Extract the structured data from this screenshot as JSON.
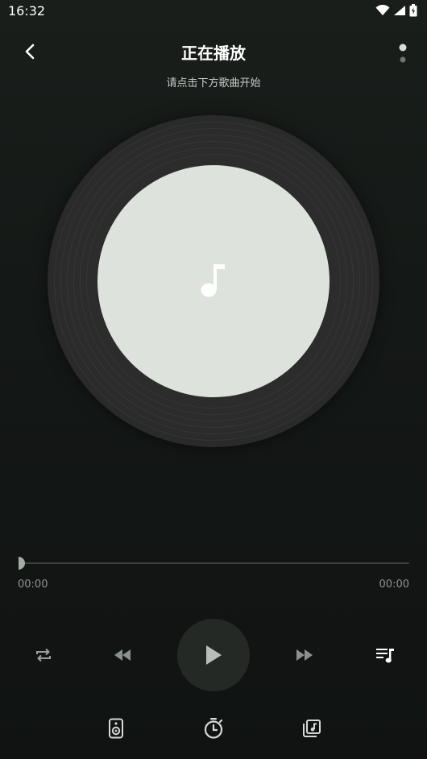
{
  "status_bar": {
    "time": "16:32"
  },
  "header": {
    "title": "正在播放",
    "subtitle": "请点击下方歌曲开始"
  },
  "player": {
    "current_time": "00:00",
    "total_time": "00:00",
    "progress": 0
  },
  "icons": {
    "back": "chevron-left-icon",
    "more": "more-dots-icon",
    "disc_center": "music-note-icon",
    "repeat": "repeat-icon",
    "previous": "rewind-icon",
    "play": "play-icon",
    "next": "fast-forward-icon",
    "playlist": "playlist-icon",
    "speaker": "speaker-icon",
    "timer": "timer-icon",
    "library": "music-library-icon"
  },
  "colors": {
    "background": "#151916",
    "disc": "#2b2b2b",
    "disc_label": "#dde2dd",
    "play_button": "#242926"
  }
}
